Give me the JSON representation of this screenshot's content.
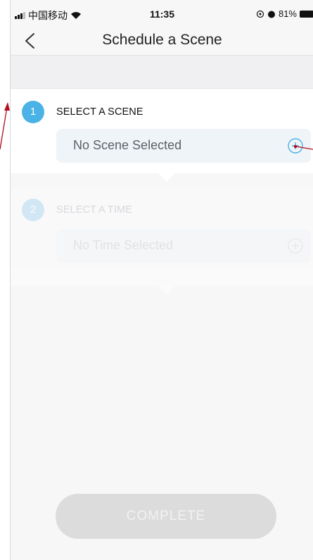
{
  "status_bar": {
    "carrier": "中国移动",
    "time": "11:35",
    "battery": "81%",
    "icons": [
      "signal-bars-icon",
      "wifi-icon",
      "location-icon",
      "alarm-icon",
      "battery-icon"
    ]
  },
  "nav": {
    "title": "Schedule a Scene",
    "back_icon": "chevron-left-icon"
  },
  "steps": [
    {
      "number": "1",
      "label": "SELECT A SCENE",
      "value": "No Scene Selected",
      "action_icon": "plus-circle-icon"
    },
    {
      "number": "2",
      "label": "SELECT A TIME",
      "value": "No Time Selected",
      "action_icon": "plus-circle-icon"
    }
  ],
  "footer": {
    "complete_label": "COMPLETE"
  },
  "colors": {
    "accent": "#4ab2e6",
    "background": "#f7f7f8",
    "button_disabled": "#dcdcdc",
    "annotation": "#b30d1e"
  }
}
